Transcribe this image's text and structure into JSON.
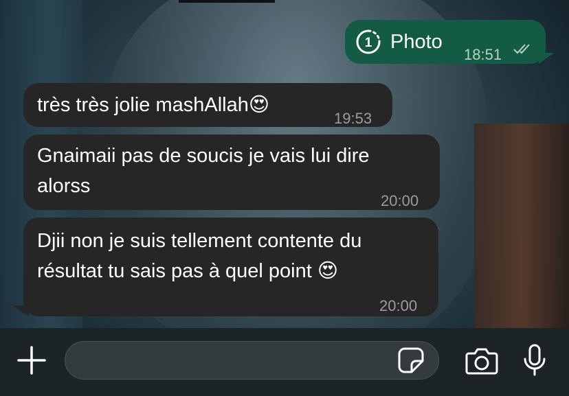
{
  "chat": {
    "messages": [
      {
        "direction": "outgoing",
        "type": "view-once-photo",
        "text": "Photo",
        "time": "18:51",
        "status": "read",
        "view_once_count": "1"
      },
      {
        "direction": "incoming",
        "text": "très très jolie mashAllah😍",
        "time": "19:53"
      },
      {
        "direction": "incoming",
        "lines": [
          "Gnaimaii pas de soucis je vais lui dire",
          "alorss"
        ],
        "time": "20:00"
      },
      {
        "direction": "incoming",
        "lines": [
          "Djii non je suis tellement contente du",
          "résultat tu sais pas à quel point 😍"
        ],
        "time": "20:00"
      }
    ]
  },
  "composer": {
    "input_value": "",
    "icons": [
      "plus-icon",
      "sticker-icon",
      "camera-icon",
      "microphone-icon"
    ]
  },
  "colors": {
    "incoming_bubble": "#262626",
    "outgoing_bubble": "#135b44",
    "composer_bg": "#1d2427"
  }
}
